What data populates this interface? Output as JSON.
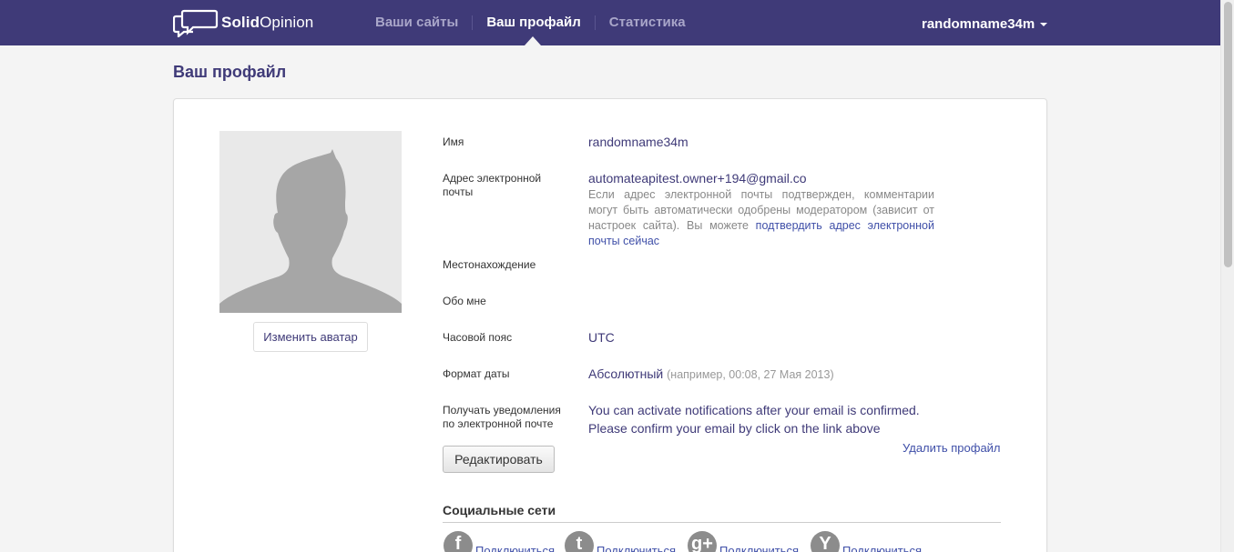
{
  "brand": {
    "name_bold": "Solid",
    "name_rest": "Opinion"
  },
  "nav": {
    "items": [
      {
        "label": "Ваши сайты"
      },
      {
        "label": "Ваш профайл"
      },
      {
        "label": "Статистика"
      }
    ],
    "active_index": 1
  },
  "user_menu": {
    "username": "randomname34m"
  },
  "page": {
    "title": "Ваш профайл"
  },
  "avatar": {
    "change_label": "Изменить аватар"
  },
  "profile": {
    "name": {
      "label": "Имя",
      "value": "randomname34m"
    },
    "email": {
      "label": "Адрес электронной почты",
      "value": "automateapitest.owner+194@gmail.co",
      "hint": "Если адрес электронной почты подтвержден, комментарии могут быть автоматически одобрены модератором (зависит от настроек сайта). Вы можете",
      "confirm_link": "подтвердить адрес электронной почты сейчас"
    },
    "location": {
      "label": "Местонахождение",
      "value": ""
    },
    "about": {
      "label": "Обо мне",
      "value": ""
    },
    "timezone": {
      "label": "Часовой пояс",
      "value": "UTC"
    },
    "date_format": {
      "label": "Формат даты",
      "value": "Абсолютный",
      "example": "(например, 00:08, 27 Мая 2013)"
    },
    "notifications": {
      "label": "Получать уведомления по электронной почте",
      "line1": "You can activate notifications after your email is confirmed.",
      "line2": "Please confirm your email by click on the link above"
    }
  },
  "actions": {
    "delete_label": "Удалить профайл",
    "edit_label": "Редактировать"
  },
  "social": {
    "title": "Социальные сети",
    "items": [
      {
        "icon": "facebook-icon",
        "glyph": "f",
        "label": "Подключиться"
      },
      {
        "icon": "twitter-icon",
        "glyph": "t",
        "label": "Подключиться"
      },
      {
        "icon": "google-plus-icon",
        "glyph": "g+",
        "label": "Подключиться"
      },
      {
        "icon": "yahoo-icon",
        "glyph": "Y",
        "label": "Подключиться"
      }
    ]
  },
  "colors": {
    "header_bg": "#3f3a78",
    "link": "#3f4fa8",
    "page_bg": "#f4f4f4"
  }
}
